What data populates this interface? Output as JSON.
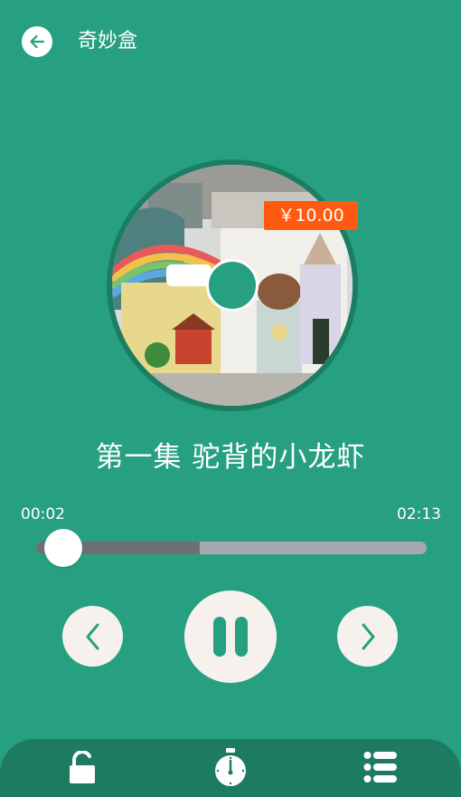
{
  "header": {
    "title": "奇妙盒",
    "back_icon": "arrow-left-icon"
  },
  "album": {
    "price": "￥10.00",
    "price_color": "#ff5a12"
  },
  "episode": {
    "title": "第一集  驼背的小龙虾"
  },
  "player": {
    "current_time": "00:02",
    "total_time": "02:13",
    "played_fraction": 0.015,
    "buffered_fraction": 0.42,
    "prev_icon": "chevron-left-icon",
    "play_pause_icon": "pause-icon",
    "next_icon": "chevron-right-icon"
  },
  "bottom_bar": {
    "items": [
      "unlock-icon",
      "stopwatch-icon",
      "playlist-icon"
    ]
  },
  "colors": {
    "background": "#26a080",
    "bar": "#1d7b61",
    "control": "#f7f1ee"
  }
}
